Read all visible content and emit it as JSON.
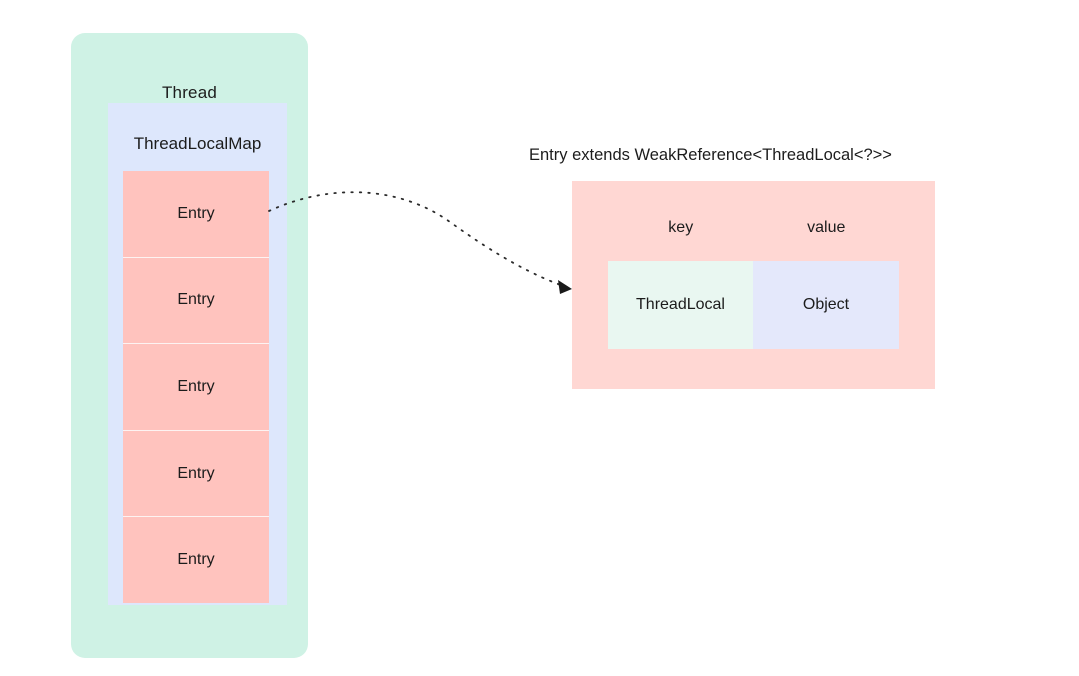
{
  "diagram": {
    "title_text": "Entry extends WeakReference<ThreadLocal<?>>",
    "thread": {
      "label": "Thread",
      "color": "#cff2e5"
    },
    "thread_local_map": {
      "label": "ThreadLocalMap",
      "color": "#dde7fc"
    },
    "entries": {
      "color": "#ffc3be",
      "items": [
        {
          "label": "Entry"
        },
        {
          "label": "Entry"
        },
        {
          "label": "Entry"
        },
        {
          "label": "Entry"
        },
        {
          "label": "Entry"
        }
      ]
    },
    "entry_detail": {
      "panel_color": "#ffd7d3",
      "columns": [
        {
          "header": "key",
          "value": "ThreadLocal",
          "color": "#e9f7f1"
        },
        {
          "header": "value",
          "value": "Object",
          "color": "#e4e8fb"
        }
      ]
    },
    "connector": {
      "name": "entry-to-detail-arrow",
      "style": "dotted-curve-with-arrowhead",
      "color": "#2b2b2b",
      "from": "Entry (first row)",
      "to": "Entry detail panel"
    }
  }
}
